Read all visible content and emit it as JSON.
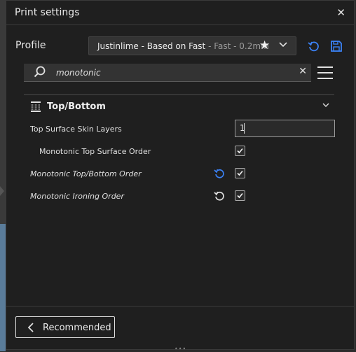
{
  "window": {
    "title": "Print settings",
    "close": "✕"
  },
  "profile": {
    "label": "Profile",
    "name": "Justinlime - Based on Fast",
    "sub": " - Fast - 0.2mm",
    "favorite": "★"
  },
  "search": {
    "value": "monotonic",
    "clear": "✕"
  },
  "category": {
    "title": "Top/Bottom"
  },
  "settings": [
    {
      "label": "Top Surface Skin Layers",
      "value": "1"
    },
    {
      "label": "Monotonic Top Surface Order",
      "checked": true
    },
    {
      "label": "Monotonic Top/Bottom Order",
      "checked": true,
      "reset_color": "#3b82f6"
    },
    {
      "label": "Monotonic Ironing Order",
      "checked": true,
      "reset_color": "#e0e0e0"
    }
  ],
  "footer": {
    "recommended": "Recommended"
  },
  "colors": {
    "accent": "#3b82f6",
    "background": "#1f1f1f"
  }
}
